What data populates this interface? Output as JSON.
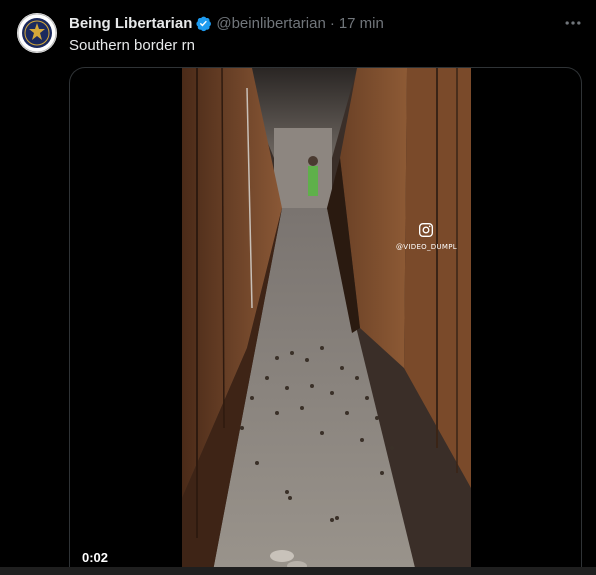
{
  "tweet": {
    "author_name": "Being Libertarian",
    "handle": "@beinlibertarian",
    "separator": "·",
    "time_ago": "17 min",
    "text": "Southern border rn"
  },
  "media": {
    "timestamp": "0:02",
    "watermark": "@VIDEO_DUMPL"
  },
  "colors": {
    "background": "#000000",
    "text": "#e7e9ea",
    "secondary": "#71767b",
    "verified": "#1d9bf0"
  },
  "icons": {
    "verified": "verified-badge-icon",
    "more": "more-icon",
    "instagram": "instagram-icon"
  }
}
